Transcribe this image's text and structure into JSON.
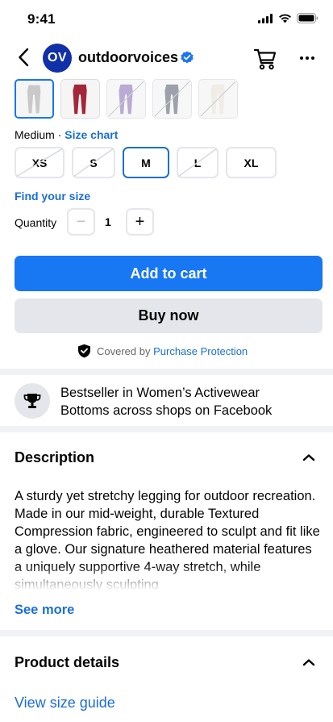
{
  "status": {
    "time": "9:41"
  },
  "header": {
    "shop_initials": "OV",
    "shop_name": "outdoorvoices",
    "icons": [
      "back-arrow-icon",
      "verified-icon",
      "cart-icon",
      "more-icon"
    ]
  },
  "colors": {
    "accent": "#1877f2",
    "link": "#1a6ed8",
    "secondary_button": "#e4e6eb",
    "avatar": "#1030a8",
    "section_divider": "#f0f2f5"
  },
  "variants": [
    {
      "color": "#c9c9c9",
      "available": true,
      "selected": true
    },
    {
      "color": "#a3263a",
      "available": true,
      "selected": false
    },
    {
      "color": "#a58fc6",
      "available": false,
      "selected": false
    },
    {
      "color": "#7d8290",
      "available": false,
      "selected": false
    },
    {
      "color": "#ece8e0",
      "available": false,
      "selected": false
    }
  ],
  "size": {
    "selected_label": "Medium",
    "separator": " · ",
    "chart_link": "Size chart",
    "options": [
      {
        "label": "XS",
        "available": false,
        "selected": false
      },
      {
        "label": "S",
        "available": false,
        "selected": false
      },
      {
        "label": "M",
        "available": true,
        "selected": true
      },
      {
        "label": "L",
        "available": false,
        "selected": false
      },
      {
        "label": "XL",
        "available": true,
        "selected": false
      }
    ],
    "find_size": "Find your size"
  },
  "quantity": {
    "label": "Quantity",
    "value": "1",
    "minus": "−",
    "plus": "+"
  },
  "actions": {
    "add_to_cart": "Add to cart",
    "buy_now": "Buy now"
  },
  "protection": {
    "prefix": "Covered by ",
    "link": "Purchase Protection"
  },
  "bestseller": {
    "line1": "Bestseller in Women’s Activewear",
    "line2": "Bottoms across shops on Facebook"
  },
  "description": {
    "title": "Description",
    "text": "A sturdy yet stretchy legging for outdoor recreation. Made in our mid-weight, durable Textured Compression fabric, engineered to sculpt and fit like a glove. Our signature heathered material features a uniquely supportive 4-way stretch, while simultaneously sculpting",
    "see_more": "See more"
  },
  "product_details": {
    "title": "Product details",
    "view_size_guide": "View size guide"
  }
}
